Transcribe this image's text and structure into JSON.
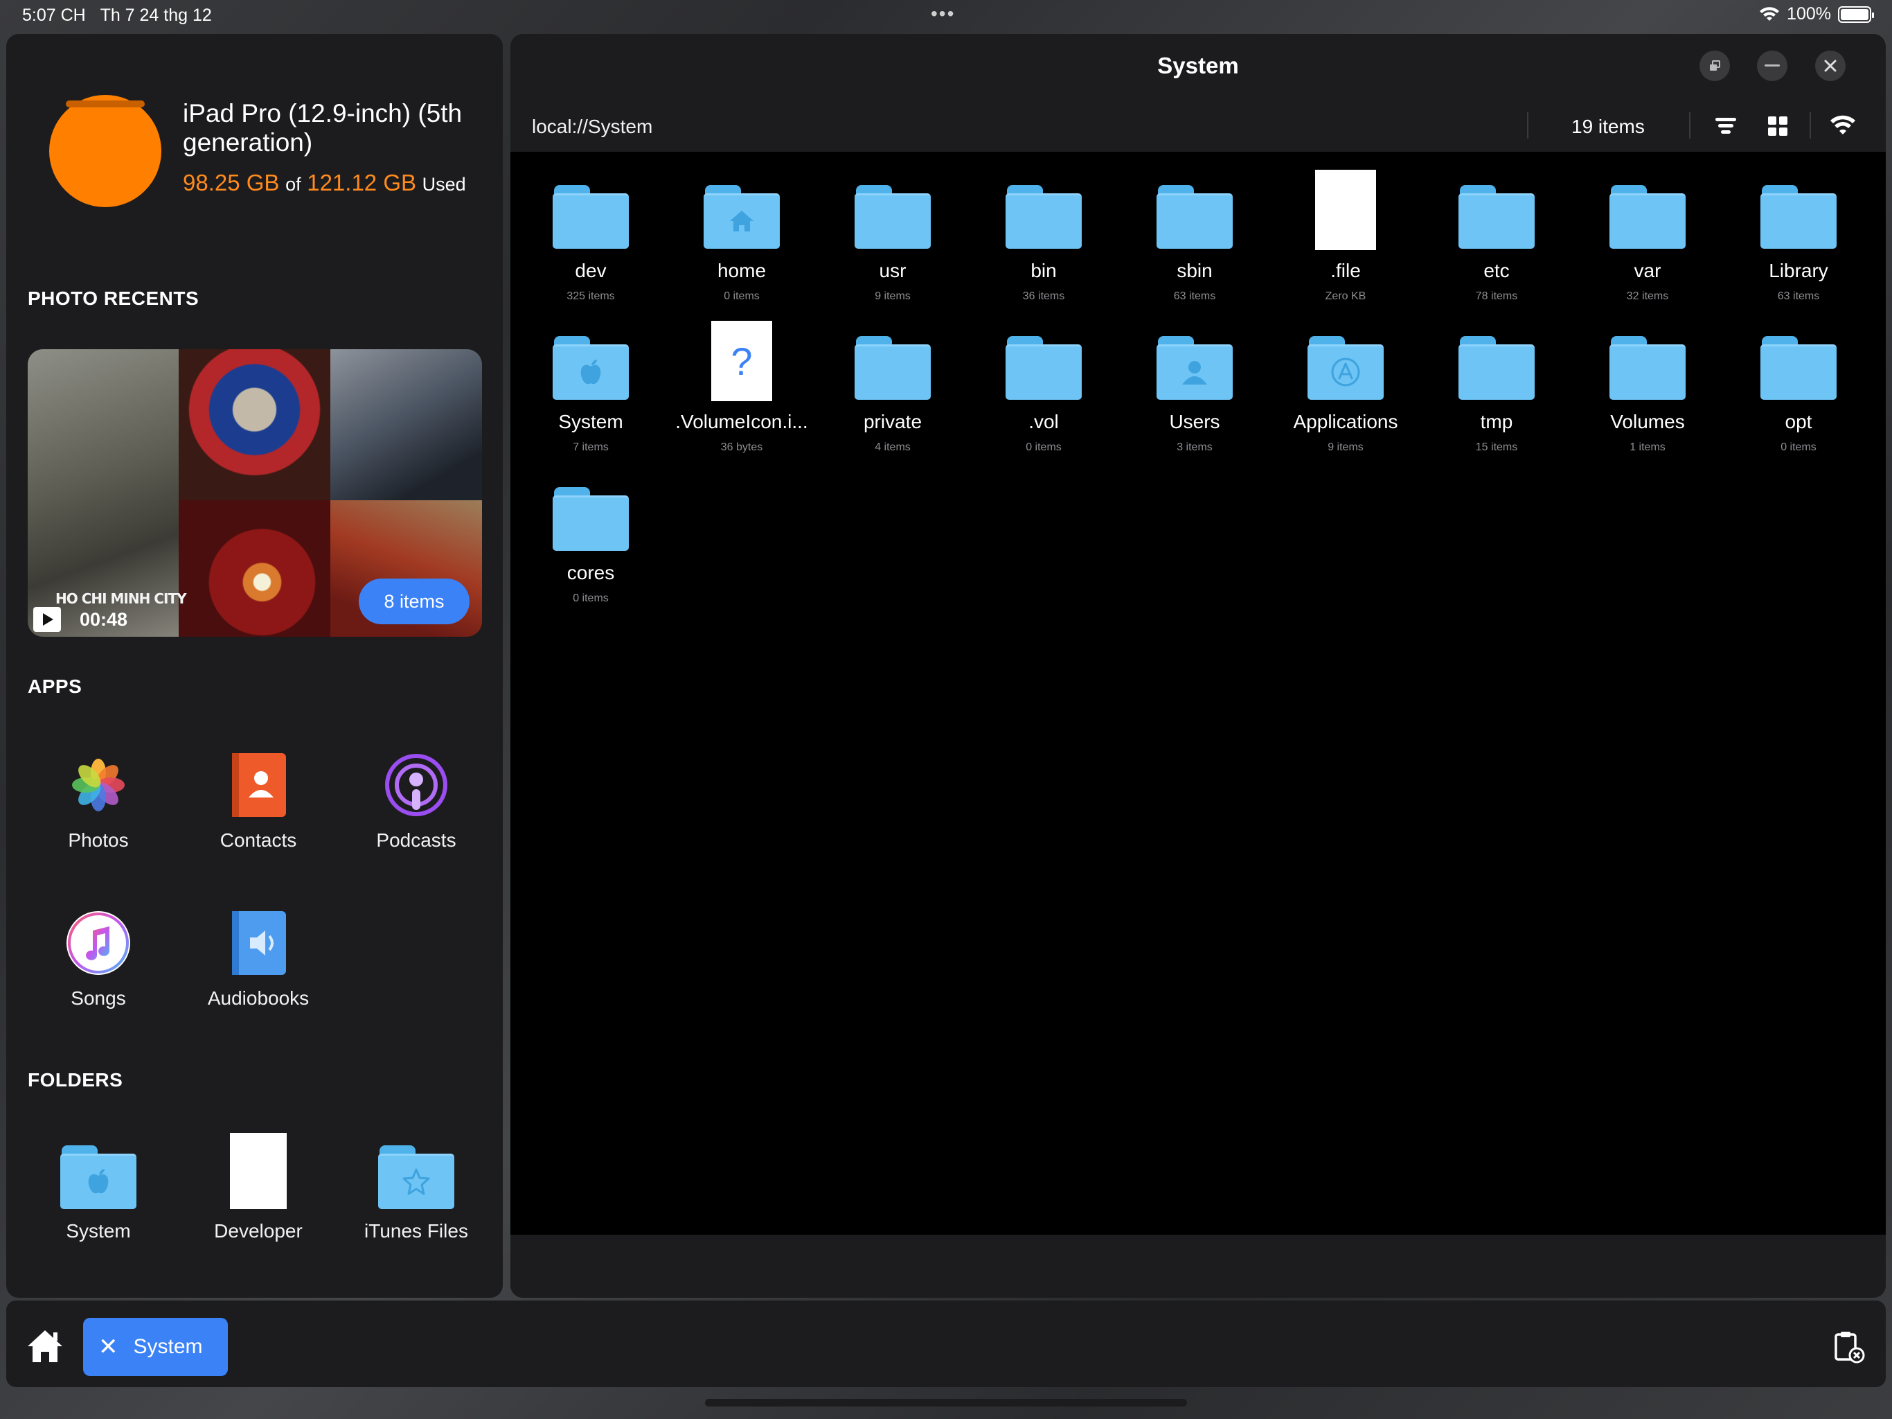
{
  "status_bar": {
    "time": "5:07 CH",
    "date": "Th 7 24 thg 12",
    "dots": "•••",
    "battery": "100%",
    "battery_level": 1.0
  },
  "sidebar": {
    "device": "iPad Pro (12.9-inch) (5th generation)",
    "storage": {
      "used": "98.25 GB",
      "of": "of",
      "total": "121.12 GB",
      "suffix": "Used",
      "used_fraction": 0.81
    },
    "photo_recents": {
      "title": "PHOTO RECENTS",
      "video_text": "HO CHI MINH CITY",
      "video_duration": "00:48",
      "badge": "8 items"
    },
    "apps": {
      "title": "APPS",
      "items": [
        {
          "label": "Photos",
          "icon": "photos-icon"
        },
        {
          "label": "Contacts",
          "icon": "contacts-icon"
        },
        {
          "label": "Podcasts",
          "icon": "podcasts-icon"
        },
        {
          "label": "Songs",
          "icon": "songs-icon"
        },
        {
          "label": "Audiobooks",
          "icon": "audiobooks-icon"
        }
      ]
    },
    "folders": {
      "title": "FOLDERS",
      "items": [
        {
          "label": "System",
          "icon": "apple-folder-icon"
        },
        {
          "label": "Developer",
          "icon": "document-icon"
        },
        {
          "label": "iTunes Files",
          "icon": "star-folder-icon"
        }
      ]
    }
  },
  "window": {
    "title": "System",
    "path": "local://System",
    "count": "19 items",
    "files": [
      {
        "name": "dev",
        "sub": "325 items",
        "kind": "folder"
      },
      {
        "name": "home",
        "sub": "0 items",
        "kind": "folder-home"
      },
      {
        "name": "usr",
        "sub": "9 items",
        "kind": "folder"
      },
      {
        "name": "bin",
        "sub": "36 items",
        "kind": "folder"
      },
      {
        "name": "sbin",
        "sub": "63 items",
        "kind": "folder"
      },
      {
        "name": ".file",
        "sub": "Zero KB",
        "kind": "file"
      },
      {
        "name": "etc",
        "sub": "78 items",
        "kind": "folder"
      },
      {
        "name": "var",
        "sub": "32 items",
        "kind": "folder"
      },
      {
        "name": "Library",
        "sub": "63 items",
        "kind": "folder"
      },
      {
        "name": "System",
        "sub": "7 items",
        "kind": "folder-apple"
      },
      {
        "name": ".VolumeIcon.i...",
        "sub": "36 bytes",
        "kind": "file-unknown"
      },
      {
        "name": "private",
        "sub": "4 items",
        "kind": "folder"
      },
      {
        "name": ".vol",
        "sub": "0 items",
        "kind": "folder"
      },
      {
        "name": "Users",
        "sub": "3 items",
        "kind": "folder-user"
      },
      {
        "name": "Applications",
        "sub": "9 items",
        "kind": "folder-apps"
      },
      {
        "name": "tmp",
        "sub": "15 items",
        "kind": "folder"
      },
      {
        "name": "Volumes",
        "sub": "1 items",
        "kind": "folder"
      },
      {
        "name": "opt",
        "sub": "0 items",
        "kind": "folder"
      },
      {
        "name": "cores",
        "sub": "0 items",
        "kind": "folder"
      }
    ]
  },
  "taskbar": {
    "tab_label": "System",
    "close_glyph": "✕"
  },
  "colors": {
    "accent": "#3b82f6",
    "storage": "#ff8a1e",
    "folder": "#6ec4f5",
    "panel": "#1c1c1e"
  }
}
